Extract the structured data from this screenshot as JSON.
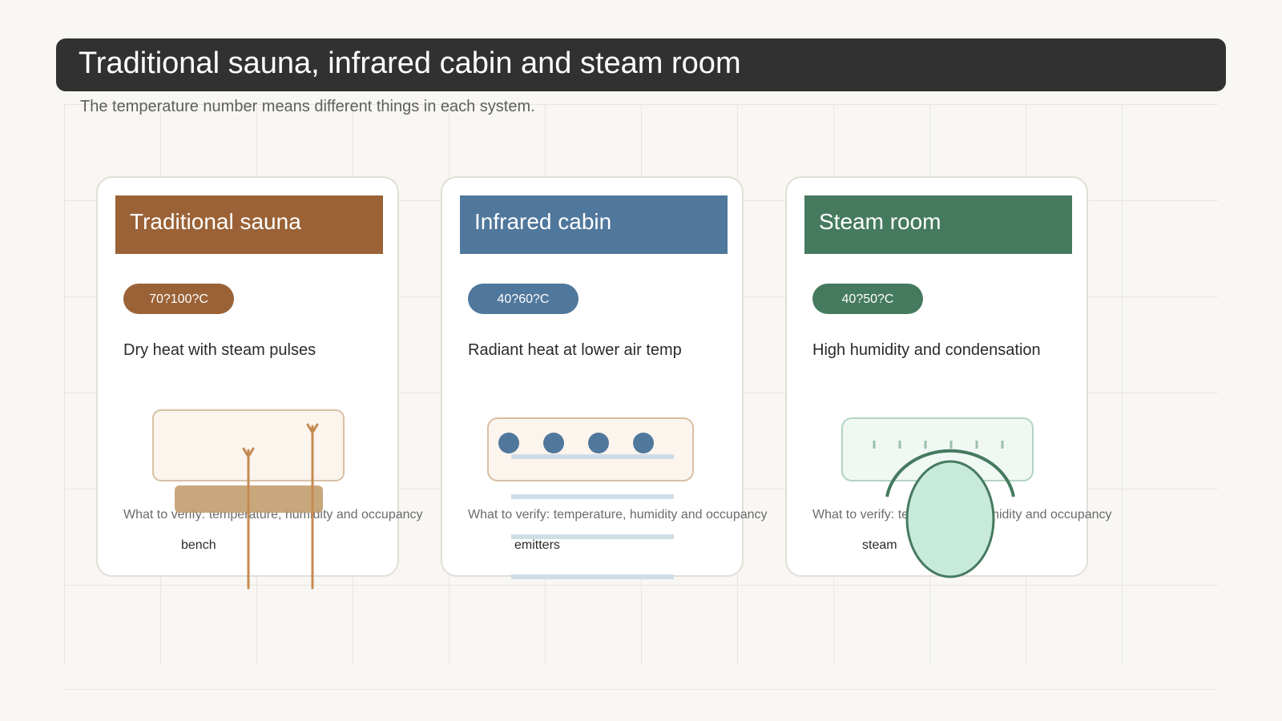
{
  "header": {
    "title": "Traditional sauna, infrared cabin and steam room",
    "subtitle": "The temperature number means different things in each system."
  },
  "cards": [
    {
      "name": "Traditional sauna",
      "temperature": "70?100?C",
      "description": "Dry heat with steam pulses",
      "verify": "What to verify: temperature, humidity and occupancy",
      "component": "bench",
      "color": "#9a6236"
    },
    {
      "name": "Infrared cabin",
      "temperature": "40?60?C",
      "description": "Radiant heat at lower air temp",
      "verify": "What to verify: temperature, humidity and occupancy",
      "component": "emitters",
      "color": "#50779c"
    },
    {
      "name": "Steam room",
      "temperature": "40?50?C",
      "description": "High humidity and condensation",
      "verify": "What to verify: temperature, humidity and occupancy",
      "component": "steam",
      "color": "#457a5f"
    }
  ]
}
